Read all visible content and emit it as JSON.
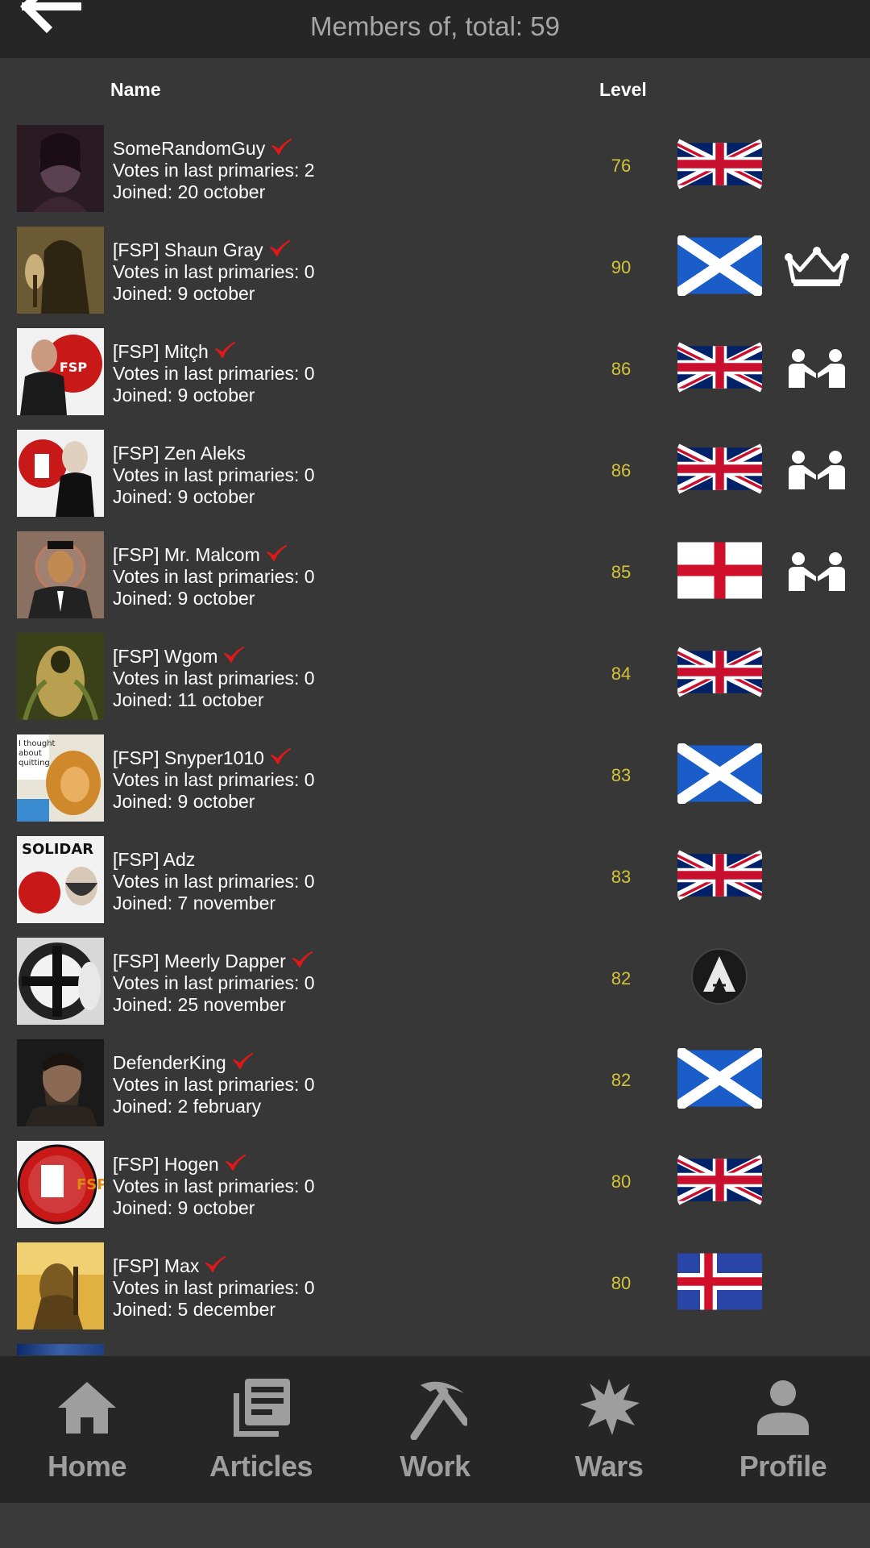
{
  "header": {
    "title": "Members of, total: 59"
  },
  "columns": {
    "name": "Name",
    "level": "Level"
  },
  "members": [
    {
      "name": "SomeRandomGuy",
      "verified": true,
      "votes": "Votes in last primaries: 2",
      "joined": "Joined: 20 october",
      "level": "76",
      "flag": "uk",
      "role": "",
      "avatar": "dark-portrait"
    },
    {
      "name": "[FSP] Shaun Gray",
      "verified": true,
      "votes": "Votes in last primaries: 0",
      "joined": "Joined: 9 october",
      "level": "90",
      "flag": "scotland",
      "role": "crown",
      "avatar": "hooded-figure"
    },
    {
      "name": "[FSP] Mitçh",
      "verified": true,
      "votes": "Votes in last primaries: 0",
      "joined": "Joined: 9 october",
      "level": "86",
      "flag": "uk",
      "role": "handshake",
      "avatar": "fsp-man"
    },
    {
      "name": "[FSP] Zen Aleks",
      "verified": false,
      "votes": "Votes in last primaries: 0",
      "joined": "Joined: 9 october",
      "level": "86",
      "flag": "uk",
      "role": "handshake",
      "avatar": "fsp-poe"
    },
    {
      "name": "[FSP] Mr. Malcom",
      "verified": true,
      "votes": "Votes in last primaries: 0",
      "joined": "Joined: 9 october",
      "level": "85",
      "flag": "england",
      "role": "handshake",
      "avatar": "suit-man"
    },
    {
      "name": "[FSP] Wgom",
      "verified": true,
      "votes": "Votes in last primaries: 0",
      "joined": "Joined: 11 october",
      "level": "84",
      "flag": "uk",
      "role": "",
      "avatar": "green-creature"
    },
    {
      "name": "[FSP] Snyper1010",
      "verified": true,
      "votes": "Votes in last primaries: 0",
      "joined": "Joined: 9 october",
      "level": "83",
      "flag": "scotland",
      "role": "",
      "avatar": "meme-lion"
    },
    {
      "name": "[FSP] Adz",
      "verified": false,
      "votes": "Votes in last primaries: 0",
      "joined": "Joined: 7 november",
      "level": "83",
      "flag": "uk",
      "role": "",
      "avatar": "solidarity"
    },
    {
      "name": "[FSP] Meerly Dapper",
      "verified": true,
      "votes": "Votes in last primaries: 0",
      "joined": "Joined: 25 november",
      "level": "82",
      "flag": "alliance",
      "role": "",
      "avatar": "cross-emblem"
    },
    {
      "name": "DefenderKing",
      "verified": true,
      "votes": "Votes in last primaries: 0",
      "joined": "Joined: 2 february",
      "level": "82",
      "flag": "scotland",
      "role": "",
      "avatar": "bearded-man"
    },
    {
      "name": "[FSP] Hogen",
      "verified": true,
      "votes": "Votes in last primaries: 0",
      "joined": "Joined: 9 october",
      "level": "80",
      "flag": "uk",
      "role": "",
      "avatar": "fsp-logo"
    },
    {
      "name": "[FSP] Max",
      "verified": true,
      "votes": "Votes in last primaries: 0",
      "joined": "Joined: 5 december",
      "level": "80",
      "flag": "iceland",
      "role": "",
      "avatar": "golden-soldier"
    }
  ],
  "nav": [
    {
      "label": "Home",
      "icon": "home-icon"
    },
    {
      "label": "Articles",
      "icon": "articles-icon"
    },
    {
      "label": "Work",
      "icon": "pickaxe-icon"
    },
    {
      "label": "Wars",
      "icon": "explosion-icon"
    },
    {
      "label": "Profile",
      "icon": "profile-icon"
    }
  ],
  "colors": {
    "level": "#d4c43a",
    "check": "#e01818",
    "nav_label": "#9e9e9e",
    "title": "#a6a6a6"
  }
}
